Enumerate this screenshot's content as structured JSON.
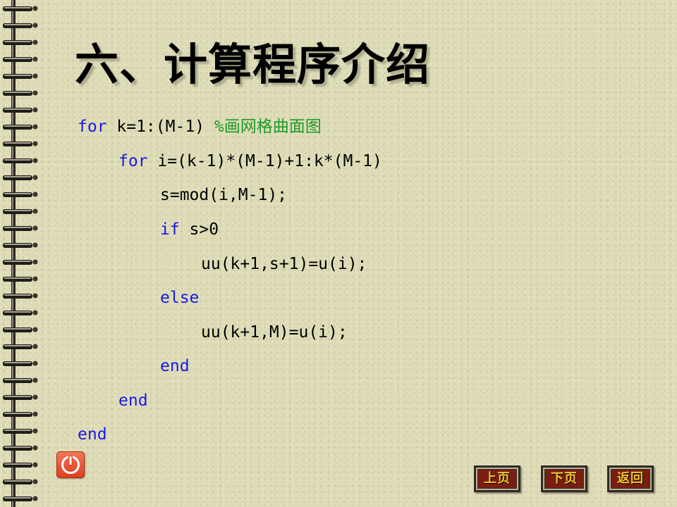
{
  "slide": {
    "title": "六、计算程序介绍"
  },
  "code": {
    "lines": [
      {
        "keyword": "for",
        "text": " k=1:(M-1) ",
        "comment": "%画网格曲面图"
      },
      {
        "keyword": "for",
        "text": " i=(k-1)*(M-1)+1:k*(M-1)"
      },
      {
        "text": "s=mod(i,M-1);"
      },
      {
        "keyword": "if",
        "text": " s>0"
      },
      {
        "text": "uu(k+1,s+1)=u(i);"
      },
      {
        "keyword": "else"
      },
      {
        "text": "uu(k+1,M)=u(i);"
      },
      {
        "keyword": "end"
      },
      {
        "keyword": "end"
      },
      {
        "keyword": "end"
      }
    ]
  },
  "nav": {
    "prev_label": "上页",
    "next_label": "下页",
    "back_label": "返回"
  },
  "icons": {
    "exit": "power-icon",
    "binding": "spiral-binding-icon"
  },
  "colors": {
    "keyword": "#1a1ae6",
    "comment": "#1f9a28",
    "nav_text": "#f2c430",
    "nav_bg": "#7a1e12",
    "exit_button": "#dc3e1e"
  }
}
